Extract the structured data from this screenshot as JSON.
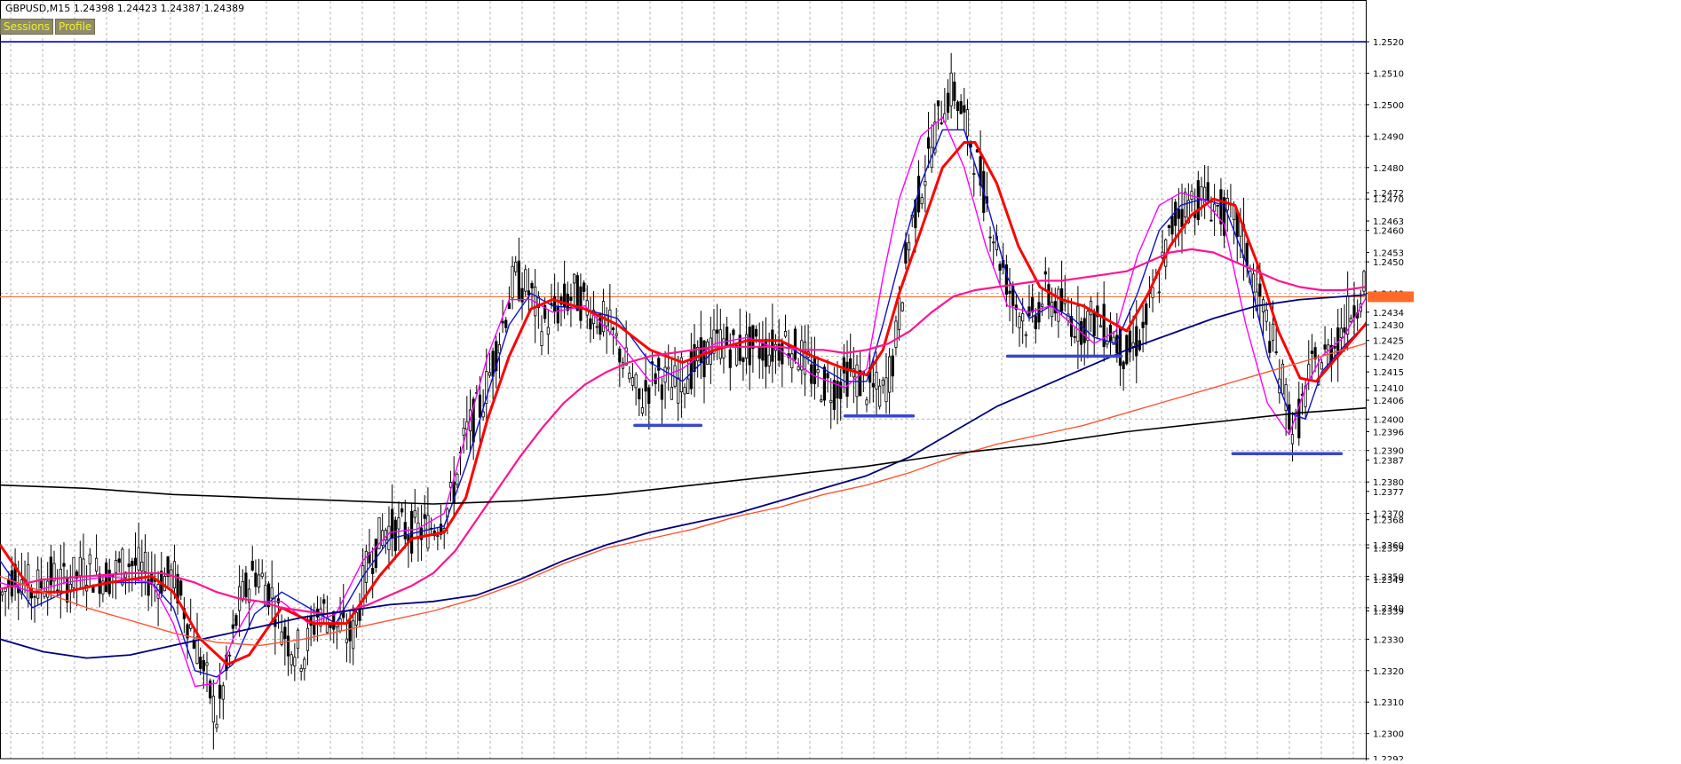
{
  "window": {
    "symbol_timeframe": "GBPUSD,M15",
    "quote": "1.24398 1.24423 1.24387 1.24389"
  },
  "buttons": {
    "sessions": "Sessions",
    "profile": "Profile"
  },
  "colors": {
    "background": "#ffffff",
    "grid": "#b4b4b4",
    "candles": "#000000",
    "ma_fast_blue": "#1010d0",
    "ma_fast_magenta": "#ff00ff",
    "ma_red": "#ff0000",
    "ma_pink": "#ff1493",
    "ma_navy": "#000080",
    "ma_orange": "#ff5533",
    "ma_black": "#000000",
    "hline_blue": "#0000cd",
    "hline_orange": "#ff6a2a",
    "marker_blue": "#3a46d0"
  },
  "chart_data": {
    "type": "line",
    "instrument": "GBPUSD",
    "timeframe": "M15",
    "ylim": [
      1.2292,
      1.2533
    ],
    "grid": true,
    "price_labels": [
      "1.2520",
      "1.2510",
      "1.2500",
      "1.2490",
      "1.2480",
      "1.2472",
      "1.2470",
      "1.2463",
      "1.2460",
      "1.2453",
      "1.2450",
      "1.2440",
      "1.2434",
      "1.2430",
      "1.2425",
      "1.2420",
      "1.2415",
      "1.2410",
      "1.2406",
      "1.2400",
      "1.2396",
      "1.2390",
      "1.2387",
      "1.2380",
      "1.2377",
      "1.2370",
      "1.2368",
      "1.2360",
      "1.2359",
      "1.2350",
      "1.2349",
      "1.2340",
      "1.2339",
      "1.2330",
      "1.2320",
      "1.2310",
      "1.2300",
      "1.2292"
    ],
    "horizontal_lines": [
      {
        "price": 1.252,
        "color": "#0000cd"
      },
      {
        "price": 1.24389,
        "color": "#ff6a2a"
      }
    ],
    "price_series": {
      "x": [
        0,
        15,
        30,
        45,
        60,
        80,
        100,
        120,
        140,
        160,
        180,
        200,
        210,
        220,
        235,
        250,
        265,
        280,
        295,
        310,
        325,
        340,
        355,
        370,
        385,
        400,
        415,
        430,
        445,
        460,
        475,
        490,
        500,
        515,
        530,
        545,
        560,
        575,
        590,
        605,
        620,
        635,
        650,
        665,
        680,
        695,
        710,
        725,
        740,
        755,
        770,
        785,
        800,
        815,
        825,
        840,
        855,
        870,
        880,
        895,
        910,
        920,
        935,
        950,
        965,
        980,
        995,
        1010,
        1025,
        1040,
        1055,
        1070,
        1085,
        1100,
        1115,
        1130,
        1145,
        1160,
        1170,
        1185,
        1195,
        1210,
        1225,
        1240,
        1255,
        1270,
        1285,
        1300,
        1315,
        1330,
        1345,
        1360,
        1375,
        1380
      ],
      "values": [
        1.2343,
        1.2352,
        1.2345,
        1.235,
        1.2348,
        1.2352,
        1.235,
        1.2355,
        1.2349,
        1.235,
        1.233,
        1.2305,
        1.232,
        1.234,
        1.2352,
        1.2345,
        1.233,
        1.2325,
        1.234,
        1.2335,
        1.233,
        1.2355,
        1.2365,
        1.2365,
        1.2364,
        1.2366,
        1.2372,
        1.2395,
        1.2405,
        1.2425,
        1.2445,
        1.244,
        1.243,
        1.2435,
        1.244,
        1.2435,
        1.243,
        1.242,
        1.2405,
        1.2415,
        1.241,
        1.2415,
        1.242,
        1.2425,
        1.2422,
        1.2423,
        1.2422,
        1.2425,
        1.242,
        1.2412,
        1.241,
        1.2415,
        1.241,
        1.2408,
        1.242,
        1.246,
        1.248,
        1.25,
        1.2505,
        1.249,
        1.247,
        1.2455,
        1.2438,
        1.243,
        1.244,
        1.2435,
        1.243,
        1.2432,
        1.2428,
        1.242,
        1.2428,
        1.2445,
        1.2465,
        1.247,
        1.247,
        1.2465,
        1.246,
        1.244,
        1.243,
        1.241,
        1.2395,
        1.2415,
        1.242,
        1.243,
        1.244,
        1.2455,
        1.2465,
        1.247,
        1.2472,
        1.2465,
        1.2465,
        1.2463,
        1.244,
        1.2439
      ]
    },
    "series": [
      {
        "color": "#1010d0",
        "x": [
          0,
          30,
          60,
          100,
          140,
          160,
          180,
          200,
          215,
          235,
          260,
          285,
          310,
          335,
          360,
          385,
          410,
          430,
          450,
          470,
          490,
          510,
          540,
          570,
          600,
          630,
          660,
          690,
          720,
          750,
          780,
          800,
          815,
          830,
          850,
          870,
          890,
          910,
          930,
          950,
          970,
          990,
          1010,
          1030,
          1050,
          1070,
          1090,
          1110,
          1130,
          1150,
          1170,
          1190,
          1205,
          1220,
          1240,
          1260,
          1280,
          1300,
          1320,
          1340,
          1360,
          1375
        ],
        "values": [
          1.2355,
          1.234,
          1.2345,
          1.2348,
          1.2348,
          1.234,
          1.232,
          1.2318,
          1.2322,
          1.2338,
          1.2345,
          1.234,
          1.2335,
          1.235,
          1.2362,
          1.2364,
          1.2366,
          1.2385,
          1.2408,
          1.243,
          1.244,
          1.2436,
          1.2435,
          1.2432,
          1.2418,
          1.2412,
          1.2422,
          1.2425,
          1.2425,
          1.2418,
          1.2412,
          1.2412,
          1.243,
          1.245,
          1.2475,
          1.2492,
          1.2492,
          1.247,
          1.2445,
          1.2432,
          1.2436,
          1.2432,
          1.2426,
          1.2424,
          1.244,
          1.246,
          1.2468,
          1.247,
          1.2468,
          1.245,
          1.242,
          1.2402,
          1.24,
          1.2415,
          1.2423,
          1.243,
          1.2445,
          1.246,
          1.2465,
          1.2468,
          1.2466,
          1.2458
        ]
      },
      {
        "color": "#ff00ff",
        "x": [
          0,
          30,
          60,
          100,
          140,
          160,
          180,
          200,
          215,
          235,
          260,
          285,
          310,
          335,
          360,
          385,
          410,
          430,
          450,
          470,
          490,
          510,
          540,
          570,
          600,
          630,
          660,
          690,
          720,
          750,
          780,
          800,
          815,
          830,
          850,
          870,
          890,
          910,
          930,
          950,
          970,
          990,
          1010,
          1030,
          1050,
          1070,
          1090,
          1110,
          1130,
          1150,
          1170,
          1190,
          1205,
          1220,
          1240,
          1260,
          1280,
          1300,
          1320,
          1340,
          1360,
          1375
        ],
        "values": [
          1.2348,
          1.2345,
          1.2348,
          1.235,
          1.2348,
          1.2335,
          1.2315,
          1.2316,
          1.233,
          1.2342,
          1.2342,
          1.2335,
          1.2338,
          1.2355,
          1.2364,
          1.2365,
          1.237,
          1.2395,
          1.242,
          1.2438,
          1.2438,
          1.2434,
          1.2436,
          1.2425,
          1.2412,
          1.2416,
          1.2424,
          1.2426,
          1.2422,
          1.2414,
          1.241,
          1.2416,
          1.2445,
          1.247,
          1.249,
          1.2496,
          1.248,
          1.2455,
          1.2436,
          1.2434,
          1.2436,
          1.243,
          1.2424,
          1.2428,
          1.2452,
          1.2468,
          1.2472,
          1.247,
          1.2462,
          1.243,
          1.2405,
          1.2395,
          1.241,
          1.242,
          1.2426,
          1.2438,
          1.2455,
          1.2463,
          1.2468,
          1.2469,
          1.246,
          1.2448
        ]
      },
      {
        "color": "#ff0000",
        "x": [
          0,
          30,
          60,
          100,
          140,
          160,
          185,
          210,
          230,
          260,
          290,
          320,
          350,
          380,
          410,
          430,
          450,
          470,
          490,
          510,
          540,
          570,
          600,
          630,
          660,
          690,
          720,
          750,
          780,
          800,
          815,
          830,
          850,
          870,
          890,
          900,
          920,
          940,
          960,
          980,
          1000,
          1020,
          1040,
          1060,
          1080,
          1100,
          1120,
          1140,
          1160,
          1180,
          1200,
          1215,
          1235,
          1260,
          1280,
          1300,
          1320,
          1340,
          1360,
          1378
        ],
        "values": [
          1.236,
          1.2345,
          1.2345,
          1.2348,
          1.235,
          1.2345,
          1.233,
          1.2322,
          1.2325,
          1.234,
          1.2335,
          1.2335,
          1.235,
          1.2362,
          1.2364,
          1.2375,
          1.24,
          1.242,
          1.2435,
          1.2438,
          1.2435,
          1.243,
          1.2422,
          1.2418,
          1.2422,
          1.2425,
          1.2425,
          1.242,
          1.2416,
          1.2414,
          1.2422,
          1.244,
          1.246,
          1.248,
          1.2488,
          1.2488,
          1.2475,
          1.2455,
          1.2442,
          1.2438,
          1.2436,
          1.2432,
          1.2428,
          1.244,
          1.2455,
          1.2465,
          1.247,
          1.2468,
          1.245,
          1.2428,
          1.2413,
          1.2412,
          1.242,
          1.243,
          1.244,
          1.2452,
          1.246,
          1.2466,
          1.2469,
          1.2463
        ]
      },
      {
        "color": "#ff1493",
        "x": [
          0,
          40,
          80,
          120,
          150,
          180,
          200,
          220,
          240,
          260,
          280,
          300,
          320,
          340,
          360,
          380,
          400,
          420,
          440,
          460,
          480,
          500,
          520,
          540,
          560,
          580,
          600,
          620,
          640,
          660,
          680,
          700,
          720,
          740,
          760,
          780,
          800,
          820,
          840,
          860,
          880,
          900,
          920,
          940,
          960,
          980,
          1000,
          1020,
          1040,
          1060,
          1080,
          1100,
          1120,
          1140,
          1160,
          1180,
          1200,
          1220,
          1240,
          1260,
          1280,
          1300,
          1320,
          1340,
          1360,
          1378
        ],
        "values": [
          1.2346,
          1.2349,
          1.235,
          1.2351,
          1.2351,
          1.2348,
          1.2345,
          1.2343,
          1.2342,
          1.234,
          1.2339,
          1.2338,
          1.2339,
          1.2341,
          1.2344,
          1.2347,
          1.2351,
          1.2358,
          1.2368,
          1.2378,
          1.2388,
          1.2397,
          1.2405,
          1.2411,
          1.2415,
          1.2418,
          1.242,
          1.2421,
          1.2422,
          1.2423,
          1.2423,
          1.2423,
          1.2423,
          1.2422,
          1.2422,
          1.2421,
          1.2422,
          1.2424,
          1.2428,
          1.2434,
          1.2439,
          1.2441,
          1.2442,
          1.2443,
          1.2444,
          1.2444,
          1.2445,
          1.2446,
          1.2447,
          1.245,
          1.2453,
          1.2454,
          1.2453,
          1.245,
          1.2447,
          1.2444,
          1.2442,
          1.2441,
          1.2441,
          1.2442,
          1.2443,
          1.2444,
          1.2445,
          1.2445,
          1.2444,
          1.2443
        ]
      },
      {
        "color": "#000080",
        "x": [
          0,
          40,
          80,
          120,
          160,
          200,
          240,
          280,
          320,
          360,
          400,
          440,
          480,
          520,
          560,
          600,
          640,
          680,
          720,
          760,
          800,
          840,
          880,
          920,
          960,
          1000,
          1040,
          1080,
          1120,
          1160,
          1200,
          1240,
          1280,
          1320,
          1360,
          1378
        ],
        "values": [
          1.233,
          1.2326,
          1.2324,
          1.2325,
          1.2328,
          1.2331,
          1.2334,
          1.2337,
          1.2339,
          1.2341,
          1.2342,
          1.2344,
          1.2349,
          1.2355,
          1.236,
          1.2364,
          1.2367,
          1.237,
          1.2374,
          1.2378,
          1.2382,
          1.2388,
          1.2396,
          1.2404,
          1.241,
          1.2416,
          1.2422,
          1.2427,
          1.2432,
          1.2436,
          1.2438,
          1.2439,
          1.244,
          1.2441,
          1.2442,
          1.2442
        ]
      },
      {
        "color": "#ff5533",
        "x": [
          0,
          40,
          80,
          120,
          160,
          200,
          240,
          280,
          320,
          360,
          400,
          440,
          480,
          520,
          560,
          600,
          640,
          680,
          720,
          760,
          800,
          840,
          880,
          920,
          960,
          1000,
          1040,
          1080,
          1120,
          1160,
          1200,
          1240,
          1280,
          1320,
          1360,
          1378
        ],
        "values": [
          1.235,
          1.2345,
          1.234,
          1.2336,
          1.2332,
          1.2329,
          1.2328,
          1.233,
          1.2333,
          1.2336,
          1.2339,
          1.2343,
          1.2348,
          1.2354,
          1.2359,
          1.2362,
          1.2365,
          1.2369,
          1.2372,
          1.2376,
          1.2379,
          1.2383,
          1.2388,
          1.2392,
          1.2395,
          1.2398,
          1.2402,
          1.2406,
          1.241,
          1.2414,
          1.2418,
          1.2422,
          1.2426,
          1.243,
          1.2434,
          1.2436
        ]
      },
      {
        "color": "#000000",
        "x": [
          0,
          80,
          160,
          240,
          320,
          400,
          480,
          560,
          640,
          720,
          800,
          880,
          960,
          1040,
          1120,
          1200,
          1280,
          1378
        ],
        "values": [
          1.2379,
          1.2378,
          1.2376,
          1.2375,
          1.2374,
          1.2373,
          1.2374,
          1.2376,
          1.2379,
          1.2382,
          1.2385,
          1.2389,
          1.2392,
          1.2396,
          1.2399,
          1.2402,
          1.2404,
          1.2407
        ]
      }
    ],
    "annotations": [
      {
        "type": "support-marker",
        "price": 1.2398,
        "x_start": 586,
        "x_end": 647,
        "color": "#3a46d0"
      },
      {
        "type": "support-marker",
        "price": 1.2401,
        "x_start": 780,
        "x_end": 843,
        "color": "#3a46d0"
      },
      {
        "type": "support-marker",
        "price": 1.242,
        "x_start": 930,
        "x_end": 1035,
        "color": "#3a46d0"
      },
      {
        "type": "support-marker",
        "price": 1.2389,
        "x_start": 1138,
        "x_end": 1238,
        "color": "#3a46d0"
      }
    ]
  }
}
